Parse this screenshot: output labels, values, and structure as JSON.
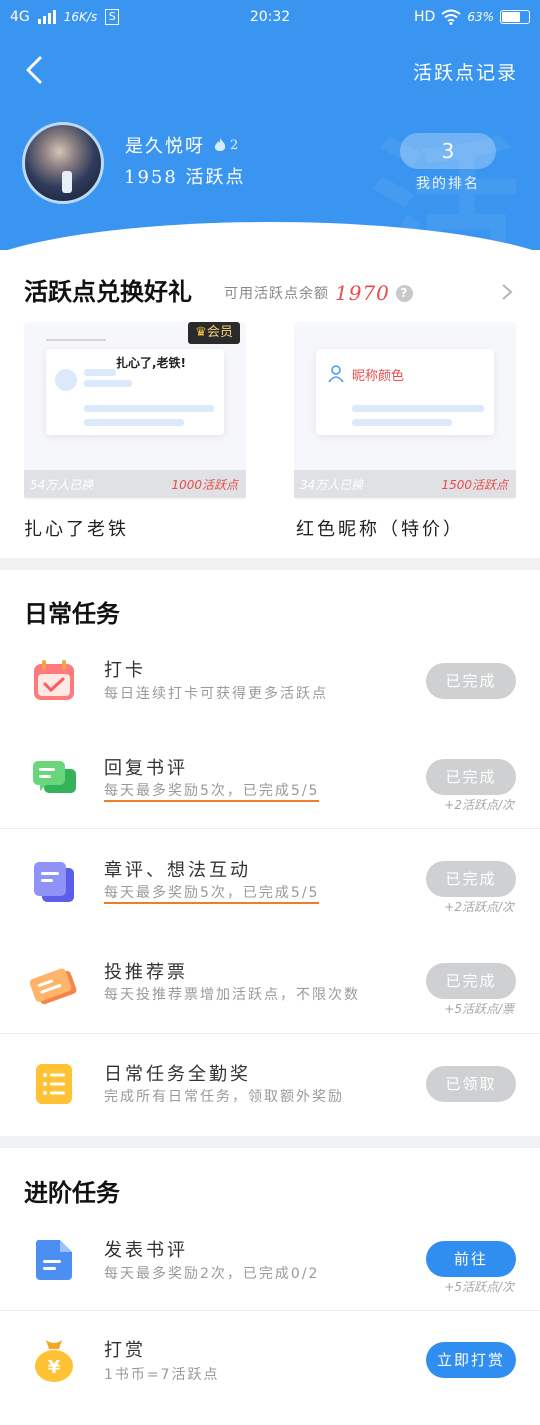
{
  "status_bar": {
    "network": "4G",
    "speed": "16K/s",
    "sim": "S",
    "time": "20:32",
    "hd": "HD",
    "battery": "63%"
  },
  "header": {
    "records_link": "活跃点记录",
    "username": "是久悦呀",
    "fire_level": "2",
    "points_text": "1958 活跃点",
    "rank_value": "3",
    "rank_label": "我的排名",
    "colors": {
      "primary": "#3a95f0"
    }
  },
  "exchange": {
    "title": "活跃点兑换好礼",
    "balance_label": "可用活跃点余额",
    "balance_value": "1970",
    "help_icon": "?",
    "items": [
      {
        "badge": "会员",
        "preview_text": "扎心了,老铁!",
        "exchanged": "54万人已换",
        "cost": "1000活跃点",
        "name": "扎心了老铁"
      },
      {
        "preview_text": "昵称颜色",
        "exchanged": "34万人已换",
        "cost": "1500活跃点",
        "name": "红色昵称（特价）"
      }
    ]
  },
  "daily": {
    "title": "日常任务",
    "tasks": [
      {
        "name": "打卡",
        "desc": "每日连续打卡可获得更多活跃点",
        "button": "已完成",
        "note": ""
      },
      {
        "name": "回复书评",
        "desc": "每天最多奖励5次，已完成5/5",
        "button": "已完成",
        "note": "+2活跃点/次"
      },
      {
        "name": "章评、想法互动",
        "desc": "每天最多奖励5次，已完成5/5",
        "button": "已完成",
        "note": "+2活跃点/次"
      },
      {
        "name": "投推荐票",
        "desc": "每天投推荐票增加活跃点，不限次数",
        "button": "已完成",
        "note": "+5活跃点/票"
      },
      {
        "name": "日常任务全勤奖",
        "desc": "完成所有日常任务，领取额外奖励",
        "button": "已领取",
        "note": ""
      }
    ]
  },
  "advanced": {
    "title": "进阶任务",
    "tasks": [
      {
        "name": "发表书评",
        "desc": "每天最多奖励2次，已完成0/2",
        "button": "前往",
        "note": "+5活跃点/次"
      },
      {
        "name": "打赏",
        "desc": "1书币=7活跃点",
        "button": "立即打赏",
        "note": ""
      }
    ]
  }
}
